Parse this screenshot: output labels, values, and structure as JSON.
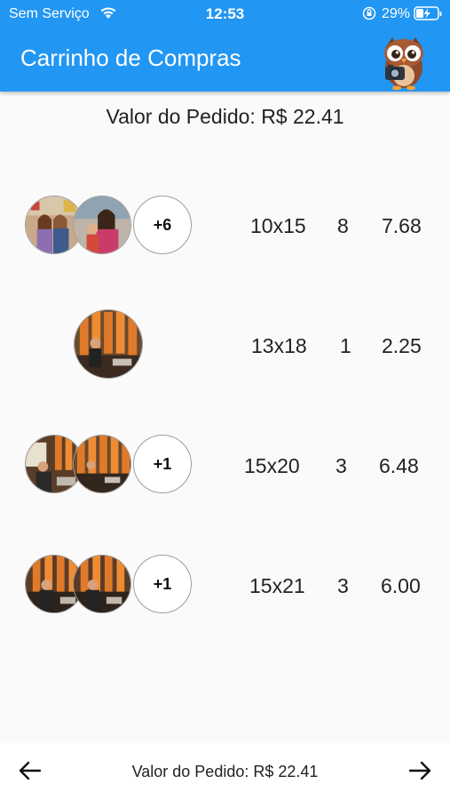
{
  "status": {
    "carrier": "Sem Serviço",
    "time": "12:53",
    "battery": "29%"
  },
  "appbar": {
    "title": "Carrinho de Compras",
    "logo_icon": "owl-camera-icon"
  },
  "order": {
    "total_label": "Valor do Pedido: R$ 22.41"
  },
  "items": [
    {
      "more": "+6",
      "size": "10x15",
      "qty": "8",
      "price": "7.68"
    },
    {
      "more": "",
      "size": "13x18",
      "qty": "1",
      "price": "2.25"
    },
    {
      "more": "+1",
      "size": "15x20",
      "qty": "3",
      "price": "6.48"
    },
    {
      "more": "+1",
      "size": "15x21",
      "qty": "3",
      "price": "6.00"
    }
  ],
  "bottom": {
    "label": "Valor do Pedido: R$ 22.41",
    "back_icon": "arrow-left-icon",
    "forward_icon": "arrow-right-icon"
  },
  "colors": {
    "appbar": "#2196f3",
    "background": "#fafafa"
  }
}
